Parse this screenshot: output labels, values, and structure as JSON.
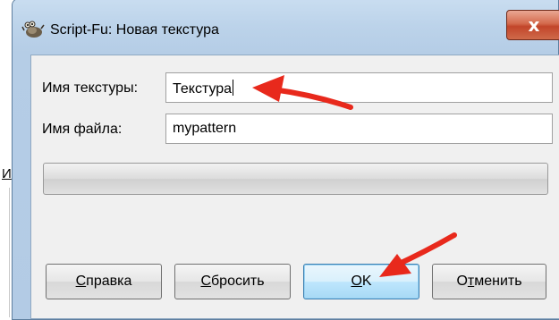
{
  "background": {
    "partial_letter": "И"
  },
  "window": {
    "title": "Script-Fu: Новая текстура",
    "close_glyph": "x"
  },
  "form": {
    "pattern_name_label": "Имя текстуры:",
    "pattern_name_value": "Текстура",
    "file_name_label": "Имя файла:",
    "file_name_value": "mypattern"
  },
  "buttons": {
    "help": {
      "mnemonic": "С",
      "rest": "правка"
    },
    "reset": {
      "mnemonic": "С",
      "rest": "бросить"
    },
    "ok": {
      "mnemonic": "О",
      "rest": "K"
    },
    "cancel": {
      "first": "О",
      "mnemonic": "т",
      "rest": "менить"
    }
  },
  "colors": {
    "annotation_arrow": "#e8291c",
    "close_button": "#c8452a",
    "titlebar": "#bcd3ea"
  }
}
